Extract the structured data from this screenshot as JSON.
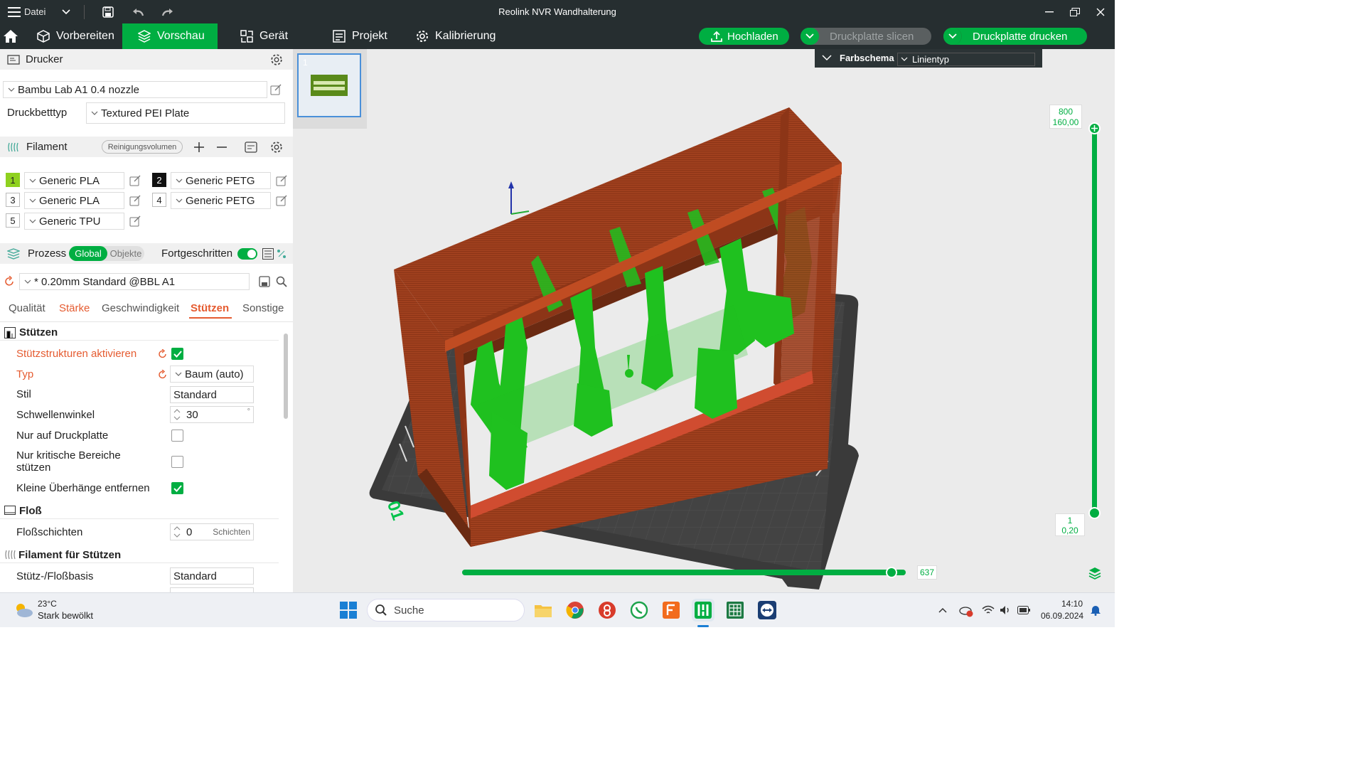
{
  "window": {
    "title": "Reolink NVR Wandhalterung",
    "file_menu": "Datei"
  },
  "menubar": {
    "tabs": [
      {
        "label": "Vorbereiten",
        "active": false
      },
      {
        "label": "Vorschau",
        "active": true
      },
      {
        "label": "Gerät",
        "active": false
      },
      {
        "label": "Projekt",
        "active": false
      },
      {
        "label": "Kalibrierung",
        "active": false
      }
    ],
    "upload_label": "Hochladen",
    "slice_label": "Druckplatte slicen",
    "print_label": "Druckplatte drucken",
    "accent": "#00ae42"
  },
  "printer": {
    "section_title": "Drucker",
    "printer_name": "Bambu Lab A1 0.4 nozzle",
    "bed_type_label": "Druckbetttyp",
    "bed_type_value": "Textured PEI Plate"
  },
  "filament": {
    "section_title": "Filament",
    "purge_button": "Reinigungsvolumen",
    "slots": [
      {
        "num": "1",
        "name": "Generic PLA",
        "color": "#8fd11f",
        "text_color": "#222"
      },
      {
        "num": "2",
        "name": "Generic PETG",
        "color": "#111111",
        "text_color": "#fff"
      },
      {
        "num": "3",
        "name": "Generic PLA",
        "color": "#ffffff",
        "text_color": "#222"
      },
      {
        "num": "4",
        "name": "Generic PETG",
        "color": "#ffffff",
        "text_color": "#222"
      },
      {
        "num": "5",
        "name": "Generic TPU",
        "color": "#ffffff",
        "text_color": "#222"
      }
    ]
  },
  "process": {
    "section_title": "Prozess",
    "toggle_global": "Global",
    "toggle_objects": "Objekte",
    "advanced_label": "Fortgeschritten",
    "advanced_on": true,
    "profile": "* 0.20mm Standard @BBL A1",
    "tabs": [
      {
        "label": "Qualität",
        "state": "normal"
      },
      {
        "label": "Stärke",
        "state": "modified"
      },
      {
        "label": "Geschwindigkeit",
        "state": "normal"
      },
      {
        "label": "Stützen",
        "state": "active"
      },
      {
        "label": "Sonstige",
        "state": "normal"
      }
    ]
  },
  "supports": {
    "group_title": "Stützen",
    "enable_label": "Stützstrukturen aktivieren",
    "enable_checked": true,
    "type_label": "Typ",
    "type_value": "Baum (auto)",
    "style_label": "Stil",
    "style_value": "Standard",
    "threshold_label": "Schwellenwinkel",
    "threshold_value": "30",
    "threshold_unit": "°",
    "plate_only_label": "Nur auf Druckplatte",
    "plate_only_checked": false,
    "critical_only_label_1": "Nur kritische Bereiche",
    "critical_only_label_2": "stützen",
    "critical_only_checked": false,
    "remove_small_label": "Kleine Überhänge entfernen",
    "remove_small_checked": true,
    "raft_group": "Floß",
    "raft_layers_label": "Floßschichten",
    "raft_layers_value": "0",
    "raft_layers_unit": "Schichten",
    "filament_group": "Filament für Stützen",
    "support_base_label": "Stütz-/Floßbasis",
    "support_base_value": "Standard"
  },
  "viewport": {
    "plate_number": "1",
    "color_scheme_label": "Farbschema",
    "color_scheme_value": "Linientyp",
    "layer_top_num": "800",
    "layer_top_height": "160,00",
    "layer_bottom_num": "1",
    "layer_bottom_height": "0,20",
    "move_slider_value": "637",
    "move_progress": 1.0,
    "plate_label": "01",
    "model_wall_color": "#a0401e",
    "support_color": "#1fc11f",
    "plate_color": "#3c3c3c"
  },
  "taskbar": {
    "weather_temp": "23°C",
    "weather_text": "Stark bewölkt",
    "search_placeholder": "Suche",
    "time": "14:10",
    "date": "06.09.2024"
  }
}
